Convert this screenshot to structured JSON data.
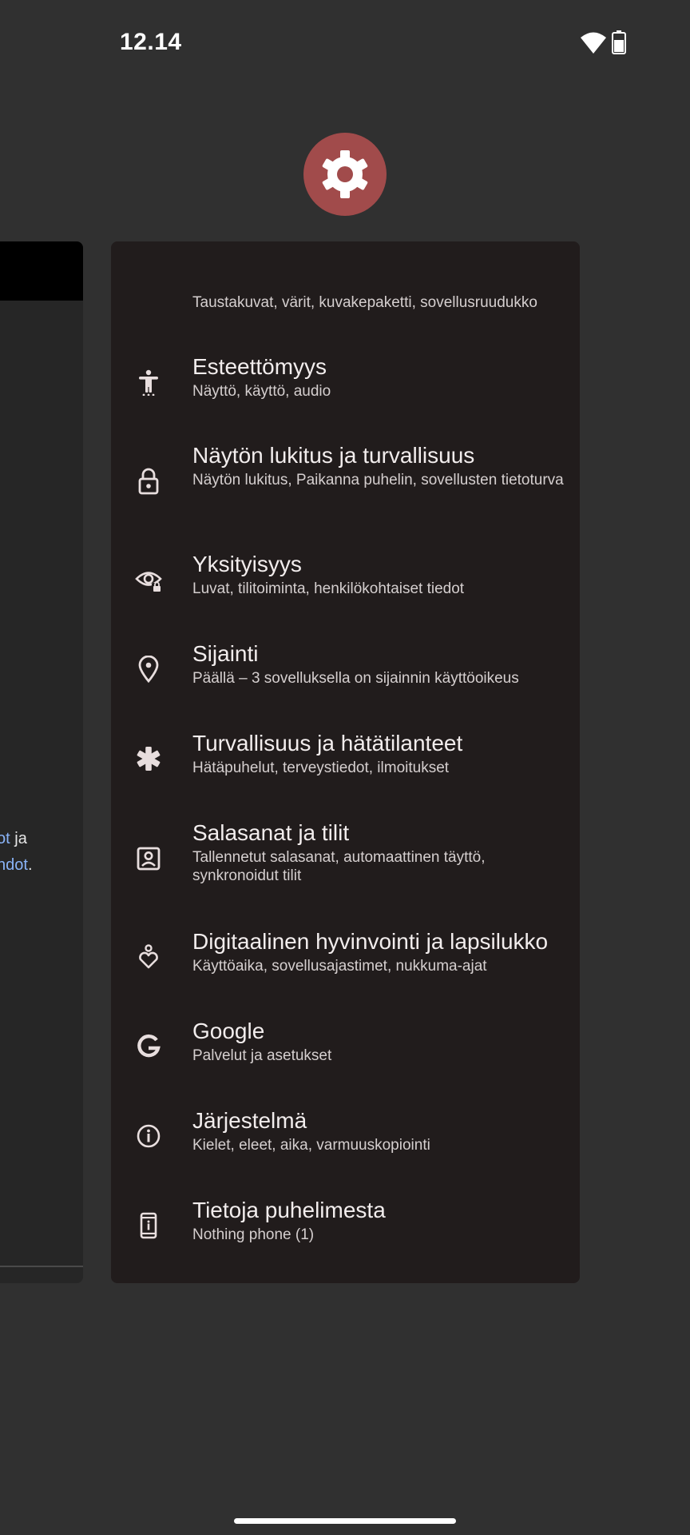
{
  "status_bar": {
    "time": "12.14",
    "icons": [
      "wifi-icon",
      "battery-icon"
    ]
  },
  "app_icon": {
    "icon": "settings-gear-icon",
    "color": "#a14b4b"
  },
  "left_card_peek": {
    "line1_link": "ot",
    "line1_text": " ja",
    "line2_link": "hdot",
    "line2_text": "."
  },
  "settings": {
    "partial_subtitle": "Taustakuvat, värit, kuvakepaketti, sovellusruudukko",
    "items": [
      {
        "icon": "accessibility-icon",
        "title": "Esteettömyys",
        "subtitle": "Näyttö, käyttö, audio"
      },
      {
        "icon": "lock-icon",
        "title": "Näytön lukitus ja turvallisuus",
        "subtitle": "Näytön lukitus, Paikanna puhelin, sovellusten tietoturva"
      },
      {
        "icon": "privacy-eye-icon",
        "title": "Yksityisyys",
        "subtitle": "Luvat, tilitoiminta, henkilökohtaiset tiedot"
      },
      {
        "icon": "location-pin-icon",
        "title": "Sijainti",
        "subtitle": "Päällä – 3 sovelluksella on sijainnin käyttöoikeus"
      },
      {
        "icon": "emergency-asterisk-icon",
        "title": "Turvallisuus ja hätätilanteet",
        "subtitle": "Hätäpuhelut, terveystiedot, ilmoitukset"
      },
      {
        "icon": "account-box-icon",
        "title": "Salasanat ja tilit",
        "subtitle": "Tallennetut salasanat, automaattinen täyttö, synkronoidut tilit"
      },
      {
        "icon": "wellbeing-icon",
        "title": "Digitaalinen hyvinvointi ja lapsilukko",
        "subtitle": "Käyttöaika, sovellusajastimet, nukkuma-ajat"
      },
      {
        "icon": "google-icon",
        "title": "Google",
        "subtitle": "Palvelut ja asetukset"
      },
      {
        "icon": "info-icon",
        "title": "Järjestelmä",
        "subtitle": "Kielet, eleet, aika, varmuuskopiointi"
      },
      {
        "icon": "phone-info-icon",
        "title": "Tietoja puhelimesta",
        "subtitle": "Nothing phone (1)"
      }
    ]
  }
}
